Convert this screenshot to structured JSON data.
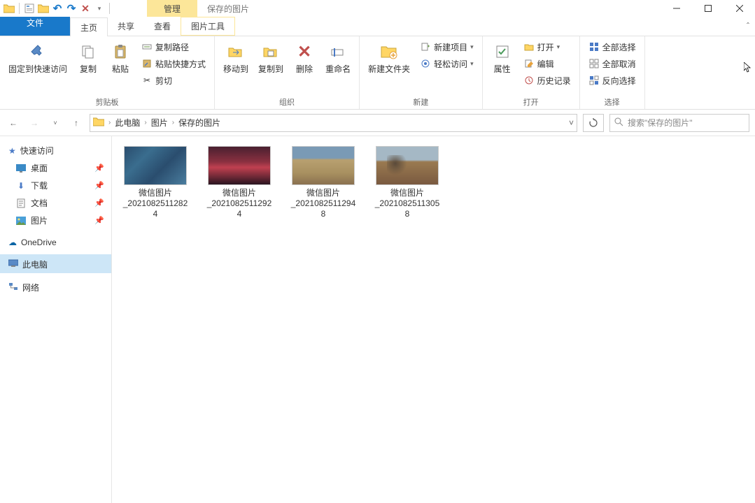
{
  "title": "保存的图片",
  "context_tab_head": "管理",
  "tabs": {
    "file": "文件",
    "home": "主页",
    "share": "共享",
    "view": "查看",
    "picture_tools": "图片工具"
  },
  "ribbon": {
    "clipboard": {
      "pin_to_quick": "固定到快速访问",
      "copy": "复制",
      "paste": "粘贴",
      "copy_path": "复制路径",
      "paste_shortcut": "粘贴快捷方式",
      "cut": "剪切",
      "group": "剪贴板"
    },
    "organize": {
      "move_to": "移动到",
      "copy_to": "复制到",
      "delete": "删除",
      "rename": "重命名",
      "group": "组织"
    },
    "new": {
      "new_folder": "新建文件夹",
      "new_item": "新建项目",
      "easy_access": "轻松访问",
      "group": "新建"
    },
    "open": {
      "properties": "属性",
      "open": "打开",
      "edit": "编辑",
      "history": "历史记录",
      "group": "打开"
    },
    "select": {
      "select_all": "全部选择",
      "select_none": "全部取消",
      "invert": "反向选择",
      "group": "选择"
    }
  },
  "breadcrumb": {
    "items": [
      "此电脑",
      "图片",
      "保存的图片"
    ]
  },
  "search_placeholder": "搜索\"保存的图片\"",
  "nav": {
    "quick_access": "快速访问",
    "desktop": "桌面",
    "downloads": "下载",
    "documents": "文档",
    "pictures": "图片",
    "onedrive": "OneDrive",
    "this_pc": "此电脑",
    "network": "网络"
  },
  "files": [
    {
      "name_line1": "微信图片",
      "name_line2": "_2021082511282",
      "name_line3": "4",
      "thumb": "ocean"
    },
    {
      "name_line1": "微信图片",
      "name_line2": "_2021082511292",
      "name_line3": "4",
      "thumb": "canyon"
    },
    {
      "name_line1": "微信图片",
      "name_line2": "_2021082511294",
      "name_line3": "8",
      "thumb": "quarry"
    },
    {
      "name_line1": "微信图片",
      "name_line2": "_2021082511305",
      "name_line3": "8",
      "thumb": "mine"
    }
  ]
}
